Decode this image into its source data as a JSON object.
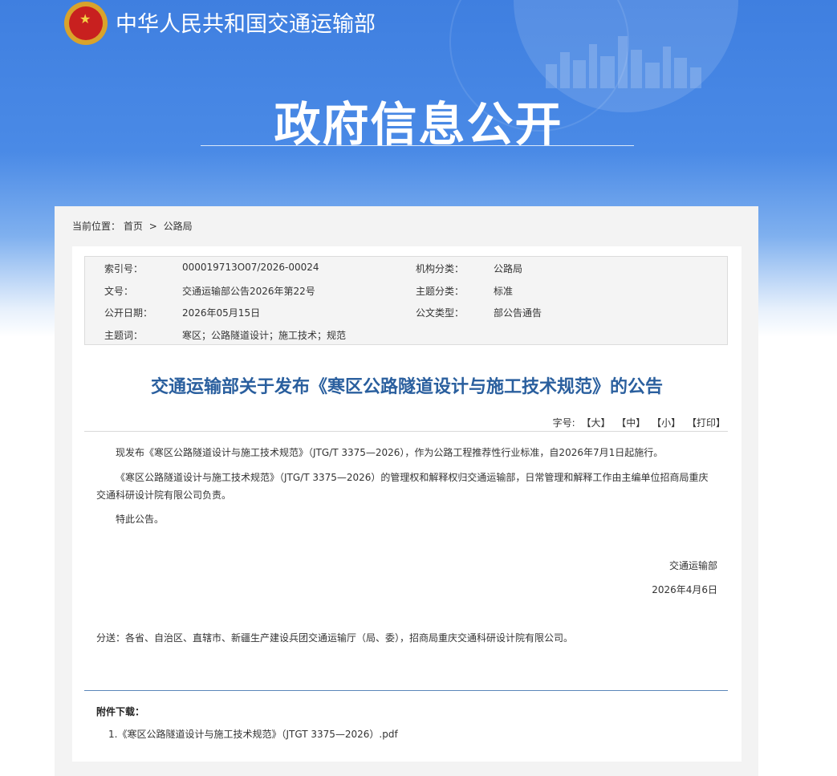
{
  "header": {
    "ministry_name": "中华人民共和国交通运输部",
    "banner_title": "政府信息公开"
  },
  "breadcrumb": {
    "label": "当前位置：",
    "home": "首页",
    "separator": ">",
    "current": "公路局"
  },
  "meta": {
    "rows": [
      {
        "k1": "索引号：",
        "v1": "000019713O07/2026-00024",
        "k2": "机构分类：",
        "v2": "公路局"
      },
      {
        "k1": "文号：",
        "v1": "交通运输部公告2026年第22号",
        "k2": "主题分类：",
        "v2": "标准"
      },
      {
        "k1": "公开日期：",
        "v1": "2026年05月15日",
        "k2": "公文类型：",
        "v2": "部公告通告"
      },
      {
        "k1": "主题词：",
        "v1": "寒区；公路隧道设计；施工技术；规范",
        "k2": "",
        "v2": ""
      }
    ]
  },
  "article": {
    "title": "交通运输部关于发布《寒区公路隧道设计与施工技术规范》的公告",
    "font_label": "字号:",
    "font_large": "【大】",
    "font_medium": "【中】",
    "font_small": "【小】",
    "print": "【打印】",
    "p1": "现发布《寒区公路隧道设计与施工技术规范》（JTG/T 3375—2026），作为公路工程推荐性行业标准，自2026年7月1日起施行。",
    "p2": "《寒区公路隧道设计与施工技术规范》（JTG/T 3375—2026）的管理权和解释权归交通运输部，日常管理和解释工作由主编单位招商局重庆交通科研设计院有限公司负责。",
    "p3": "特此公告。",
    "signer": "交通运输部",
    "sign_date": "2026年4月6日",
    "distribution": "分送：各省、自治区、直辖市、新疆生产建设兵团交通运输厅（局、委），招商局重庆交通科研设计院有限公司。"
  },
  "attachments": {
    "heading": "附件下载：",
    "items": [
      {
        "label": "1.《寒区公路隧道设计与施工技术规范》（JTGT 3375—2026）.pdf"
      }
    ]
  },
  "colors": {
    "banner_blue": "#4a8ae6",
    "title_blue": "#2a5f9e"
  }
}
